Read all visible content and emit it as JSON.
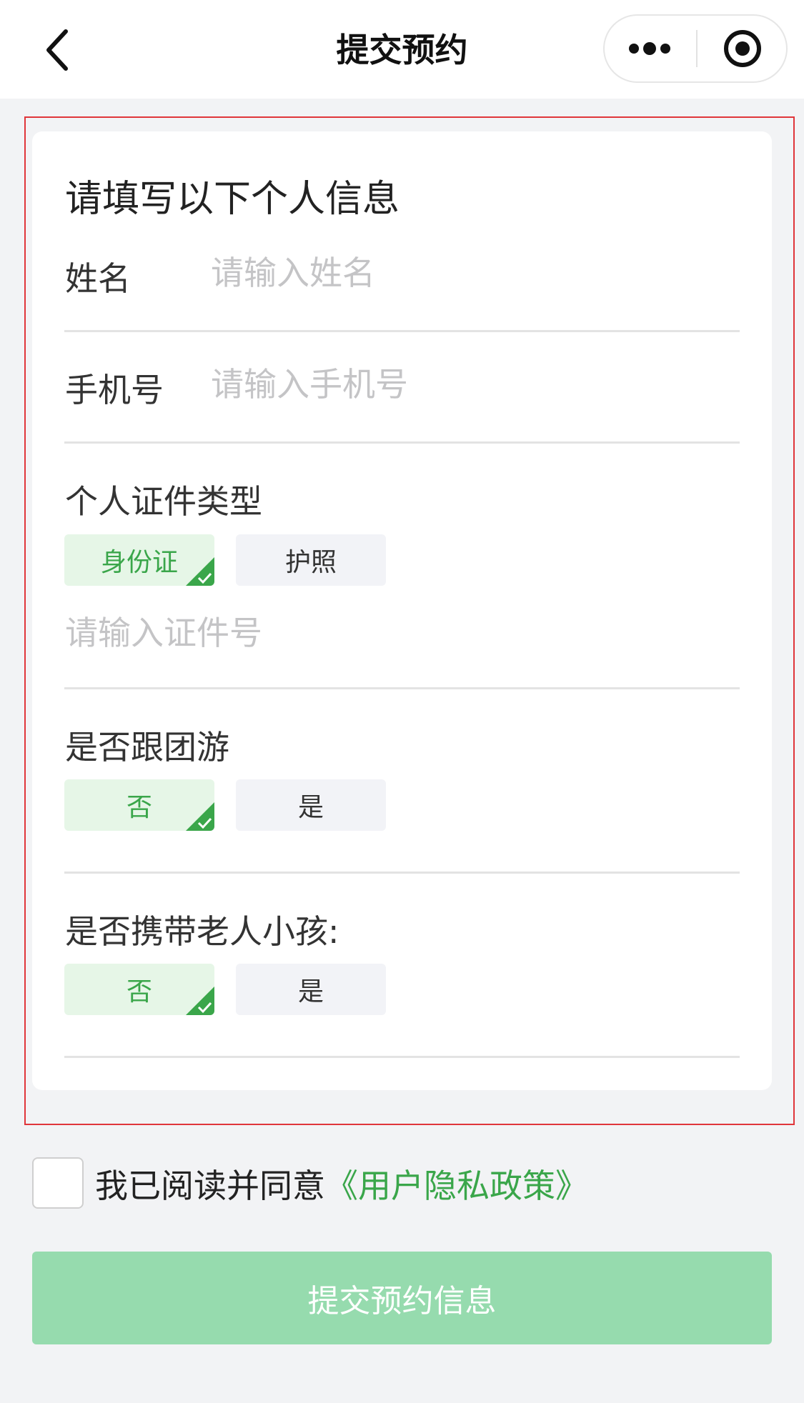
{
  "header": {
    "title": "提交预约",
    "back_icon": "chevron-left-icon",
    "more_icon": "more-dots-icon",
    "capsule_icon": "target-icon"
  },
  "form": {
    "title": "请填写以下个人信息",
    "name": {
      "label": "姓名",
      "placeholder": "请输入姓名"
    },
    "phone": {
      "label": "手机号",
      "placeholder": "请输入手机号"
    },
    "id_type": {
      "label": "个人证件类型",
      "options": [
        {
          "label": "身份证",
          "selected": true
        },
        {
          "label": "护照",
          "selected": false
        }
      ],
      "placeholder": "请输入证件号"
    },
    "group_tour": {
      "label": "是否跟团游",
      "options": [
        {
          "label": "否",
          "selected": true
        },
        {
          "label": "是",
          "selected": false
        }
      ]
    },
    "elderly_kids": {
      "label": "是否携带老人小孩:",
      "options": [
        {
          "label": "否",
          "selected": true
        },
        {
          "label": "是",
          "selected": false
        }
      ]
    }
  },
  "agreement": {
    "checked": false,
    "text": "我已阅读并同意",
    "link": "《用户隐私政策》"
  },
  "submit": {
    "label": "提交预约信息"
  },
  "colors": {
    "accent_green": "#3aa64a",
    "selected_bg": "#e6f6e7",
    "submit_bg": "#96dbae",
    "highlight_border": "#e0353a"
  }
}
